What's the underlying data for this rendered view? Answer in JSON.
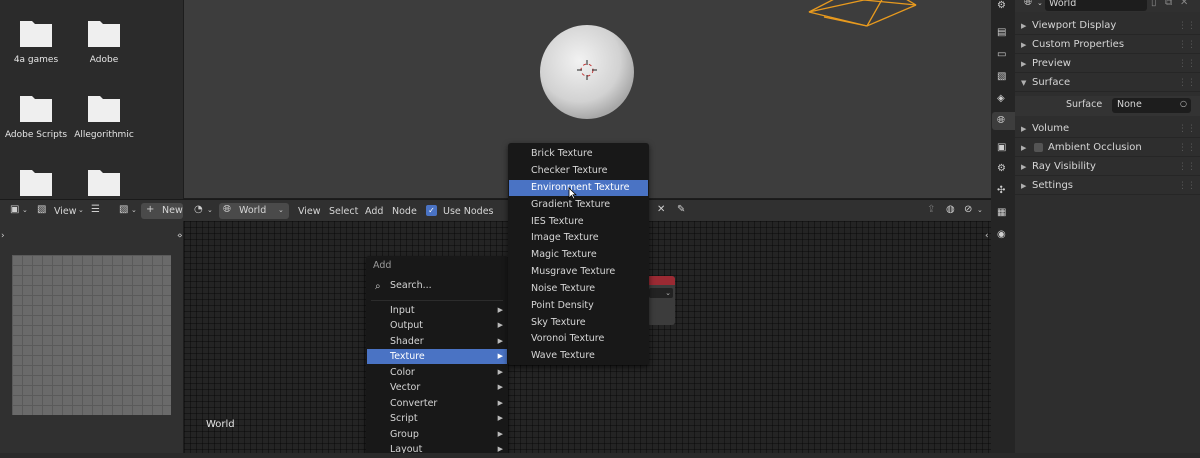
{
  "file_browser": {
    "folders": [
      {
        "label": "4a games"
      },
      {
        "label": "Adobe"
      },
      {
        "label": "Adobe Scripts"
      },
      {
        "label": "Allegorithmic"
      },
      {
        "label": ""
      },
      {
        "label": ""
      }
    ]
  },
  "image_editor": {
    "view_label": "View",
    "new_label": "New"
  },
  "node_header": {
    "world_label": "World",
    "menus": [
      "View",
      "Select",
      "Add",
      "Node"
    ],
    "use_nodes_label": "Use Nodes",
    "use_nodes_checked": true
  },
  "node_editor": {
    "world_label": "World"
  },
  "properties": {
    "world_field": "World",
    "panels": [
      {
        "label": "Viewport Display",
        "expanded": false
      },
      {
        "label": "Custom Properties",
        "expanded": false
      },
      {
        "label": "Preview",
        "expanded": false
      },
      {
        "label": "Surface",
        "expanded": true
      }
    ],
    "surface": {
      "label": "Surface",
      "value": "None"
    },
    "panels_after": [
      {
        "label": "Volume",
        "expanded": false
      },
      {
        "label": "Ambient Occlusion",
        "expanded": false,
        "checkbox": true
      },
      {
        "label": "Ray Visibility",
        "expanded": false
      },
      {
        "label": "Settings",
        "expanded": false
      }
    ]
  },
  "add_menu": {
    "title": "Add",
    "search_placeholder": "Search...",
    "items": [
      {
        "label": "Input",
        "active": false
      },
      {
        "label": "Output",
        "active": false
      },
      {
        "label": "Shader",
        "active": false
      },
      {
        "label": "Texture",
        "active": true
      },
      {
        "label": "Color",
        "active": false
      },
      {
        "label": "Vector",
        "active": false
      },
      {
        "label": "Converter",
        "active": false
      },
      {
        "label": "Script",
        "active": false
      },
      {
        "label": "Group",
        "active": false
      },
      {
        "label": "Layout",
        "active": false
      }
    ]
  },
  "texture_menu": {
    "items": [
      {
        "label": "Brick Texture",
        "active": false
      },
      {
        "label": "Checker Texture",
        "active": false
      },
      {
        "label": "Environment Texture",
        "active": true
      },
      {
        "label": "Gradient Texture",
        "active": false
      },
      {
        "label": "IES Texture",
        "active": false
      },
      {
        "label": "Image Texture",
        "active": false
      },
      {
        "label": "Magic Texture",
        "active": false
      },
      {
        "label": "Musgrave Texture",
        "active": false
      },
      {
        "label": "Noise Texture",
        "active": false
      },
      {
        "label": "Point Density",
        "active": false
      },
      {
        "label": "Sky Texture",
        "active": false
      },
      {
        "label": "Voronoi Texture",
        "active": false
      },
      {
        "label": "Wave Texture",
        "active": false
      }
    ]
  },
  "colors": {
    "highlight": "#4a73c4",
    "menu_bg": "#181818",
    "node_header_red": "#9b2a33",
    "camera_orange": "#e89a1e"
  }
}
